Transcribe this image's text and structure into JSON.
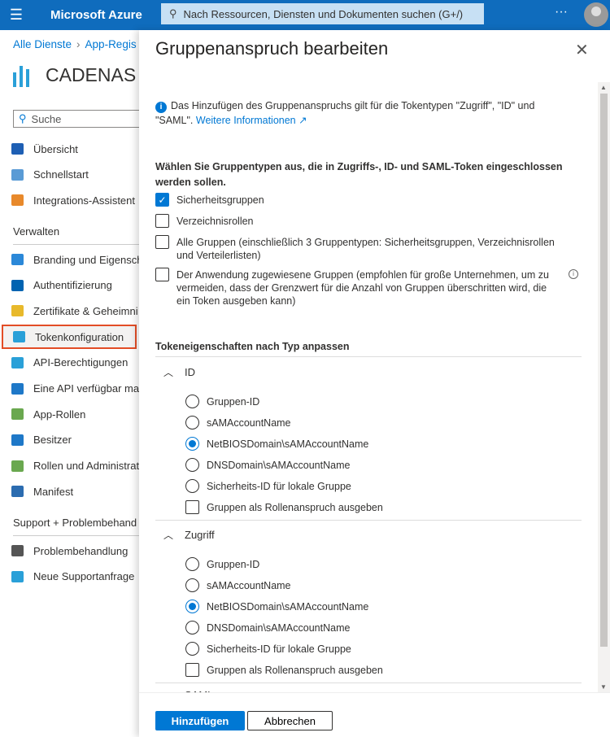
{
  "topbar": {
    "brand": "Microsoft Azure",
    "search_placeholder": "Nach Ressourcen, Diensten und Dokumenten suchen (G+/)"
  },
  "breadcrumb": [
    "Alle Dienste",
    "App-Regis"
  ],
  "app_title": "CADENAS",
  "left_search": "Suche",
  "nav_top": [
    {
      "label": "Übersicht",
      "color": "#1e5fb4"
    },
    {
      "label": "Schnellstart",
      "color": "#5a9bd5"
    },
    {
      "label": "Integrations-Assistent",
      "color": "#e8892b"
    }
  ],
  "section_verwalten": "Verwalten",
  "nav_manage": [
    {
      "label": "Branding und Eigensch",
      "color": "#2b88d8"
    },
    {
      "label": "Authentifizierung",
      "color": "#0063b1"
    },
    {
      "label": "Zertifikate & Geheimni",
      "color": "#e8b92b"
    },
    {
      "label": "Tokenkonfiguration",
      "color": "#2aa0d8"
    },
    {
      "label": "API-Berechtigungen",
      "color": "#2aa0d8"
    },
    {
      "label": "Eine API verfügbar mac",
      "color": "#1e78c8"
    },
    {
      "label": "App-Rollen",
      "color": "#6aa84f"
    },
    {
      "label": "Besitzer",
      "color": "#1e78c8"
    },
    {
      "label": "Rollen und Administrat",
      "color": "#6aa84f"
    },
    {
      "label": "Manifest",
      "color": "#2b6cb0"
    }
  ],
  "section_support": "Support + Problembehand",
  "nav_support": [
    {
      "label": "Problembehandlung",
      "color": "#555555"
    },
    {
      "label": "Neue Supportanfrage",
      "color": "#2aa0d8"
    }
  ],
  "panel": {
    "title": "Gruppenanspruch bearbeiten",
    "info_text": "Das Hinzufügen des Gruppenanspruchs gilt für die Tokentypen \"Zugriff\", \"ID\" und \"SAML\".",
    "info_link": "Weitere Informationen",
    "group_heading": "Wählen Sie Gruppentypen aus, die in Zugriffs-, ID- und SAML-Token eingeschlossen werden sollen.",
    "group_types": [
      {
        "label": "Sicherheitsgruppen",
        "checked": true
      },
      {
        "label": "Verzeichnisrollen",
        "checked": false
      },
      {
        "label": "Alle Gruppen (einschließlich 3 Gruppentypen: Sicherheitsgruppen, Verzeichnisrollen und Verteilerlisten)",
        "checked": false
      },
      {
        "label": "Der Anwendung zugewiesene Gruppen (empfohlen für große Unternehmen, um zu vermeiden, dass der Grenzwert für die Anzahl von Gruppen überschritten wird, die ein Token ausgeben kann)",
        "checked": false
      }
    ],
    "token_heading": "Tokeneigenschaften nach Typ anpassen",
    "sections": [
      {
        "title": "ID",
        "options": [
          "Gruppen-ID",
          "sAMAccountName",
          "NetBIOSDomain\\sAMAccountName",
          "DNSDomain\\sAMAccountName",
          "Sicherheits-ID für lokale Gruppe"
        ],
        "selected": 2,
        "role_claim": "Gruppen als Rollenanspruch ausgeben"
      },
      {
        "title": "Zugriff",
        "options": [
          "Gruppen-ID",
          "sAMAccountName",
          "NetBIOSDomain\\sAMAccountName",
          "DNSDomain\\sAMAccountName",
          "Sicherheits-ID für lokale Gruppe"
        ],
        "selected": 2,
        "role_claim": "Gruppen als Rollenanspruch ausgeben"
      },
      {
        "title": "SAML"
      }
    ],
    "add_button": "Hinzufügen",
    "cancel_button": "Abbrechen"
  }
}
